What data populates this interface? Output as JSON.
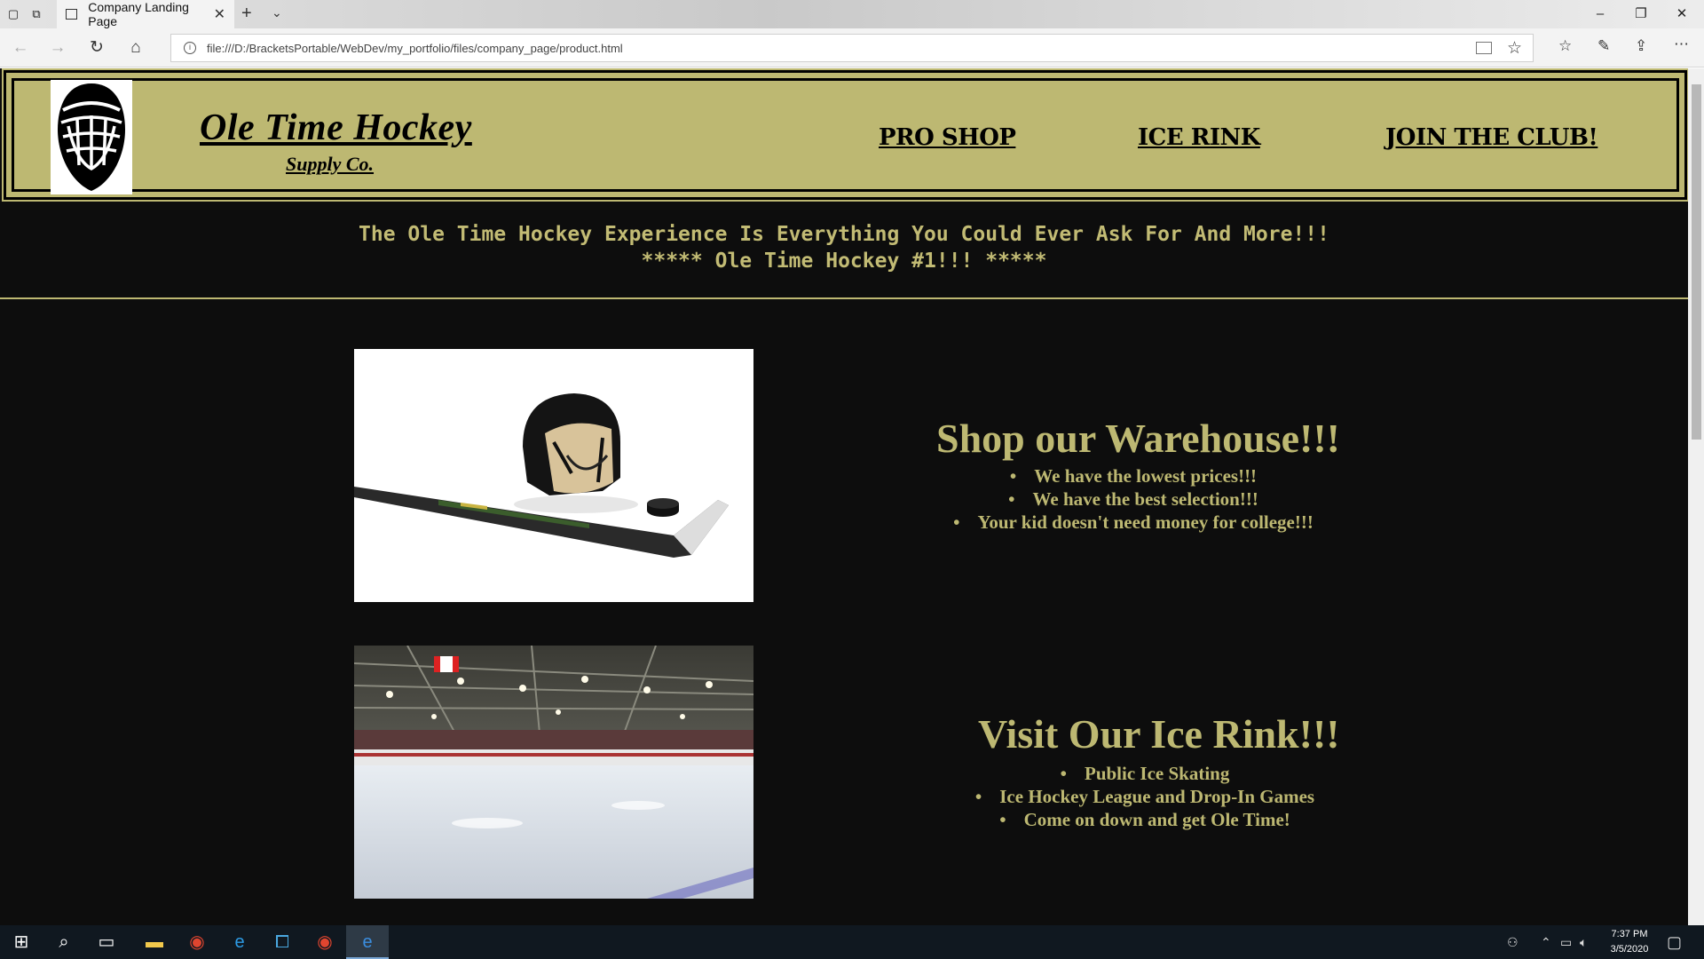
{
  "browser": {
    "tab_title": "Company Landing Page",
    "url": "file:///D:/BracketsPortable/WebDev/my_portfolio/files/company_page/product.html"
  },
  "site": {
    "brand_title": "Ole Time Hockey",
    "brand_subtitle": "Supply Co.",
    "nav": [
      "PRO SHOP",
      "ICE RINK",
      "JOIN THE CLUB!"
    ],
    "tagline_line1": "The Ole Time Hockey Experience Is Everything You Could Ever Ask For And More!!!",
    "tagline_line2": "***** Ole Time Hockey #1!!! *****",
    "sections": [
      {
        "heading": "Shop our Warehouse!!!",
        "bullets": [
          "We have the lowest prices!!!",
          "We have the best selection!!!",
          "Your kid doesn't need money for college!!!"
        ]
      },
      {
        "heading": "Visit Our Ice Rink!!!",
        "bullets": [
          "Public Ice Skating",
          "Ice Hockey League and Drop-In Games",
          "Come on down and get Ole Time!"
        ]
      }
    ]
  },
  "taskbar": {
    "time": "7:37 PM",
    "date": "3/5/2020"
  },
  "colors": {
    "gold": "#bdb872",
    "background": "#0d0d0d"
  }
}
